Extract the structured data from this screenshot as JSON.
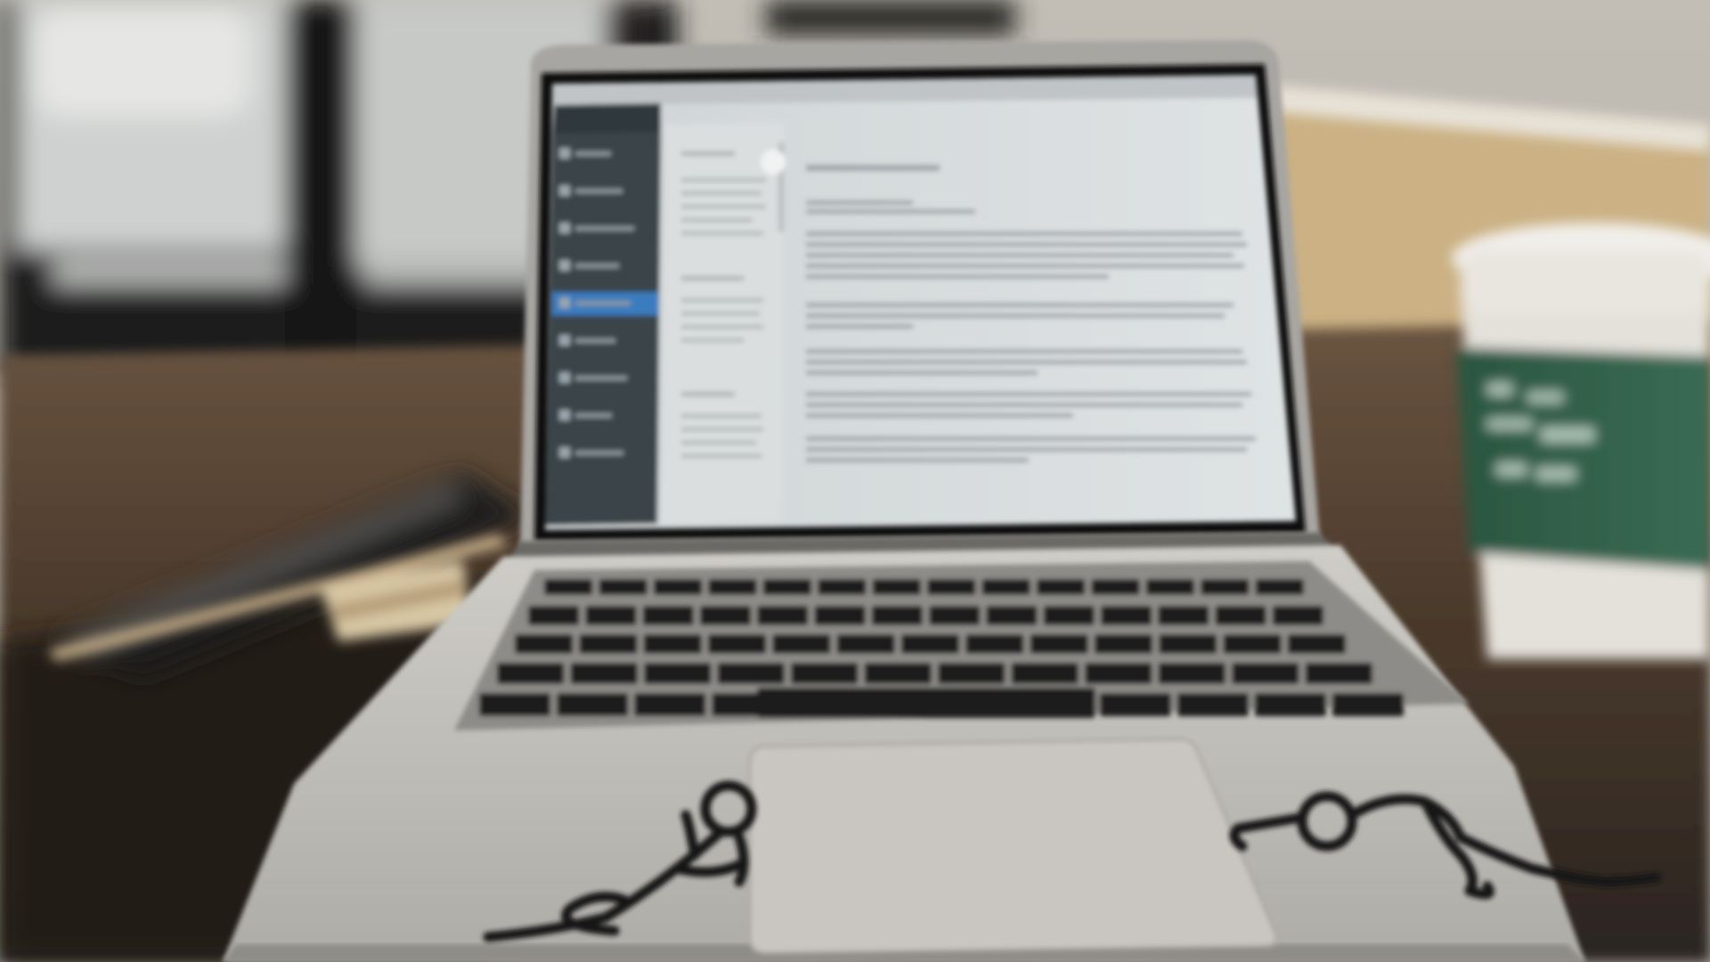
{
  "scene": {
    "subject": "laptop-on-cafe-table",
    "palette": {
      "wall": "#b7b2aa",
      "wainscot": "#cdb489",
      "window_frame": "#1b1a19",
      "table_wood": "#5a4634",
      "table_dark": "#231f1c",
      "laptop_body": "#bcbab5",
      "bezel": "#121212",
      "screen_paper": "#d4d8da",
      "sidebar": "#3b4449",
      "sidebar_highlight": "#3a7bbf",
      "keys": "#1c1c1c",
      "trackpad": "#c9c6c1",
      "cup_white": "#e6e3dd",
      "cup_sleeve": "#2f5b45",
      "decal": "#151515"
    },
    "sidebar_items": [
      "sidebar-item-1",
      "sidebar-item-2",
      "sidebar-item-3",
      "sidebar-item-4",
      "sidebar-item-5",
      "sidebar-item-6",
      "sidebar-item-7",
      "sidebar-item-8",
      "sidebar-item-9"
    ],
    "sidebar_active_index": 4
  }
}
